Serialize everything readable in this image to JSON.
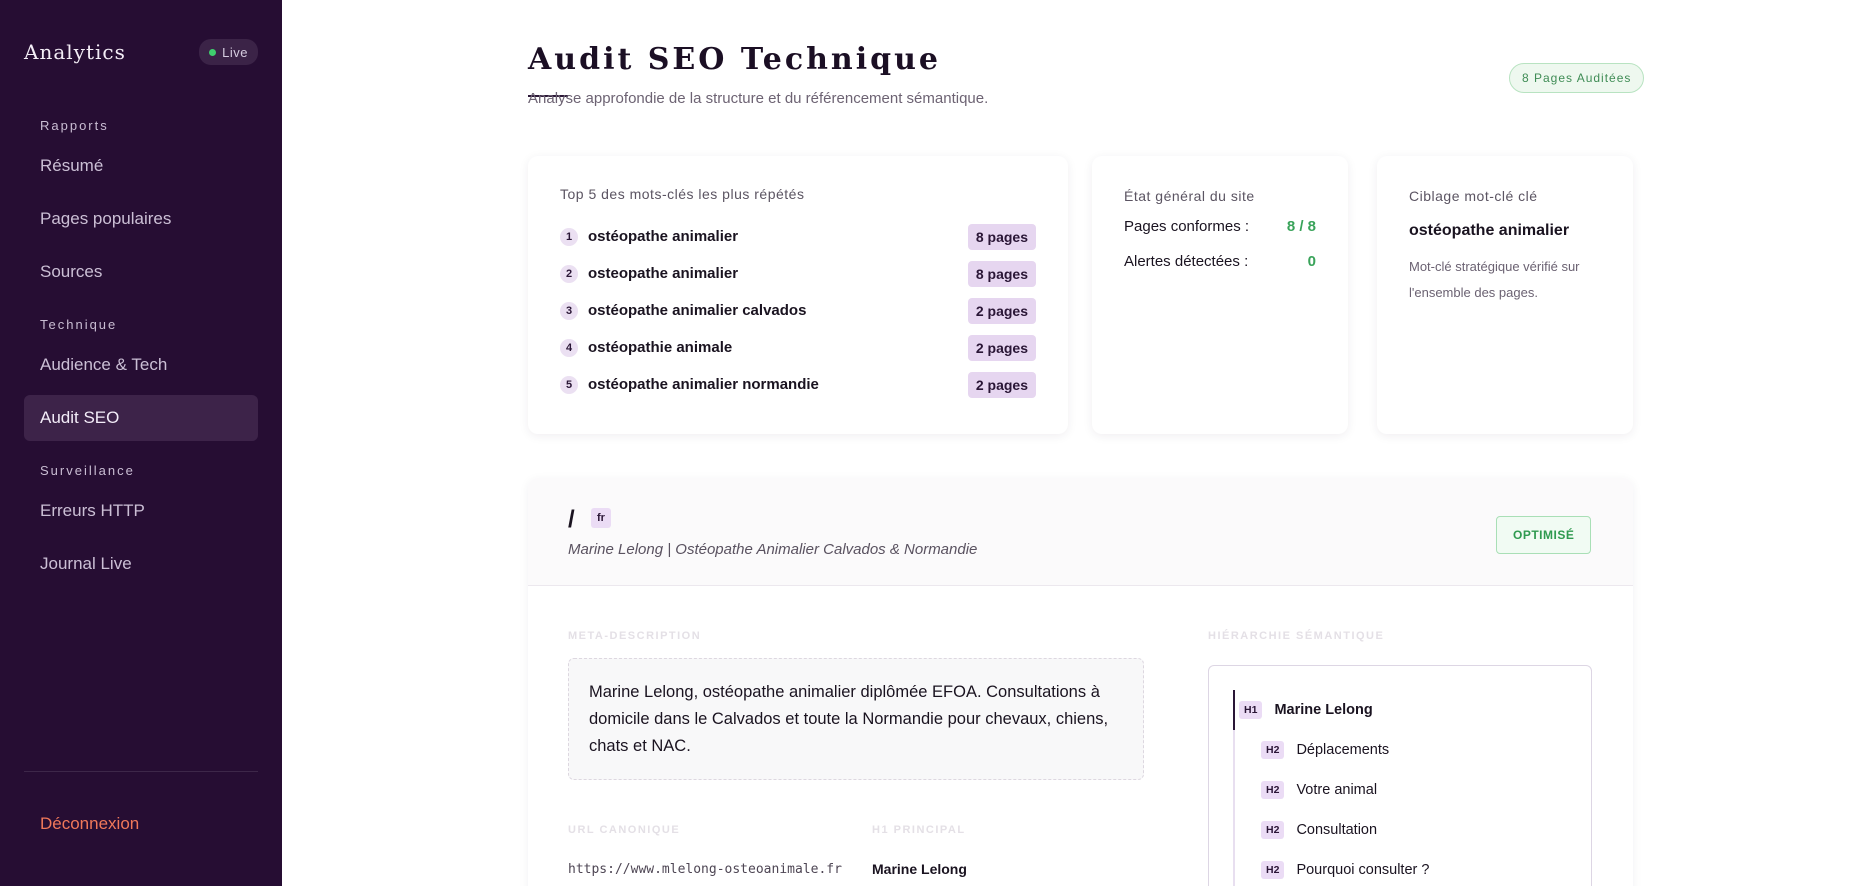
{
  "sidebar": {
    "brand": "Analytics",
    "live_label": "Live",
    "sections": [
      {
        "title": "Rapports",
        "items": [
          "Résumé",
          "Pages populaires",
          "Sources"
        ]
      },
      {
        "title": "Technique",
        "items": [
          "Audience & Tech",
          "Audit SEO"
        ]
      },
      {
        "title": "Surveillance",
        "items": [
          "Erreurs HTTP",
          "Journal Live"
        ]
      }
    ],
    "active_item": "Audit SEO",
    "logout": "Déconnexion"
  },
  "header": {
    "title": "Audit SEO Technique",
    "subtitle": "Analyse approfondie de la structure et du référencement sémantique.",
    "pages_badge": "8 Pages Auditées"
  },
  "keywords_card": {
    "title": "Top 5 des mots-clés les plus répétés",
    "items": [
      {
        "rank": "1",
        "keyword": "ostéopathe animalier",
        "count": "8 pages"
      },
      {
        "rank": "2",
        "keyword": "osteopathe animalier",
        "count": "8 pages"
      },
      {
        "rank": "3",
        "keyword": "ostéopathe animalier calvados",
        "count": "2 pages"
      },
      {
        "rank": "4",
        "keyword": "ostéopathie animale",
        "count": "2 pages"
      },
      {
        "rank": "5",
        "keyword": "ostéopathe animalier normandie",
        "count": "2 pages"
      }
    ]
  },
  "state_card": {
    "title": "État général du site",
    "conform_label": "Pages conformes :",
    "conform_value": "8 / 8",
    "alerts_label": "Alertes détectées :",
    "alerts_value": "0"
  },
  "target_card": {
    "title": "Ciblage mot-clé clé",
    "keyword": "ostéopathe animalier",
    "description": "Mot-clé stratégique vérifié sur l'ensemble des pages."
  },
  "page_detail": {
    "path": "/",
    "lang": "fr",
    "title": "Marine Lelong | Ostéopathe Animalier Calvados & Normandie",
    "status": "OPTIMISÉ",
    "meta_label": "META-DESCRIPTION",
    "meta_description": "Marine Lelong, ostéopathe animalier diplômée EFOA. Consultations à domicile dans le Calvados et toute la Normandie pour chevaux, chiens, chats et NAC.",
    "canonical_label": "URL CANONIQUE",
    "canonical_url": "https://www.mlelong-osteoanimale.fr",
    "h1_label": "H1 PRINCIPAL",
    "h1_value": "Marine Lelong",
    "hierarchy_label": "HIÉRARCHIE SÉMANTIQUE",
    "hierarchy": [
      {
        "tag": "H1",
        "text": "Marine Lelong"
      },
      {
        "tag": "H2",
        "text": "Déplacements"
      },
      {
        "tag": "H2",
        "text": "Votre animal"
      },
      {
        "tag": "H2",
        "text": "Consultation"
      },
      {
        "tag": "H2",
        "text": "Pourquoi consulter ?"
      }
    ]
  },
  "colors": {
    "sidebar_bg": "#260d33",
    "accent_badge": "#e6d6f0",
    "success": "#39a35a",
    "logout": "#f0785a"
  }
}
